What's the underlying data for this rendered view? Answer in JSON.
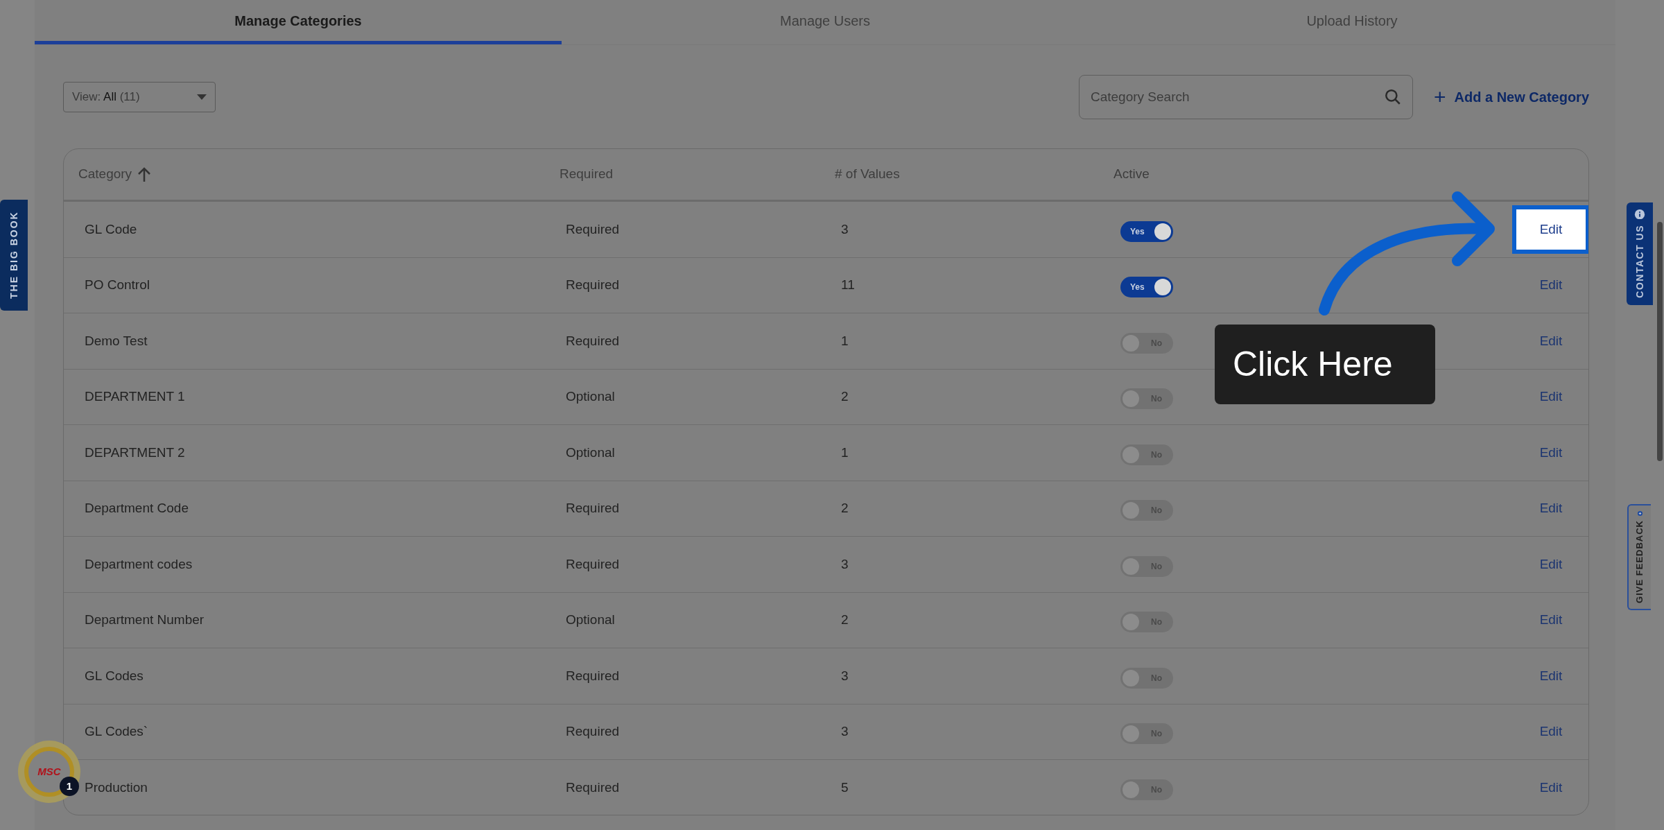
{
  "tabs": [
    {
      "label": "Manage Categories",
      "selected": true
    },
    {
      "label": "Manage Users",
      "selected": false
    },
    {
      "label": "Upload History",
      "selected": false
    }
  ],
  "view_filter": {
    "label": "View:",
    "value": "All",
    "count": "(11)"
  },
  "search": {
    "placeholder": "Category Search"
  },
  "add_button": {
    "icon": "+",
    "label": "Add a New Category"
  },
  "table": {
    "columns": [
      {
        "label": "Category",
        "sorted": true
      },
      {
        "label": "Required",
        "sorted": false
      },
      {
        "label": "# of Values",
        "sorted": false
      },
      {
        "label": "Active",
        "sorted": false
      }
    ],
    "rows": [
      {
        "category": "GL Code",
        "required": "Required",
        "values": "3",
        "active": true,
        "toggle_label": "Yes",
        "action": "Edit",
        "highlighted": true
      },
      {
        "category": "PO Control",
        "required": "Required",
        "values": "11",
        "active": true,
        "toggle_label": "Yes",
        "action": "Edit",
        "highlighted": false
      },
      {
        "category": "Demo Test",
        "required": "Required",
        "values": "1",
        "active": false,
        "toggle_label": "No",
        "action": "Edit",
        "highlighted": false
      },
      {
        "category": "DEPARTMENT 1",
        "required": "Optional",
        "values": "2",
        "active": false,
        "toggle_label": "No",
        "action": "Edit",
        "highlighted": false
      },
      {
        "category": "DEPARTMENT 2",
        "required": "Optional",
        "values": "1",
        "active": false,
        "toggle_label": "No",
        "action": "Edit",
        "highlighted": false
      },
      {
        "category": "Department Code",
        "required": "Required",
        "values": "2",
        "active": false,
        "toggle_label": "No",
        "action": "Edit",
        "highlighted": false
      },
      {
        "category": "Department codes",
        "required": "Required",
        "values": "3",
        "active": false,
        "toggle_label": "No",
        "action": "Edit",
        "highlighted": false
      },
      {
        "category": "Department Number",
        "required": "Optional",
        "values": "2",
        "active": false,
        "toggle_label": "No",
        "action": "Edit",
        "highlighted": false
      },
      {
        "category": "GL Codes",
        "required": "Required",
        "values": "3",
        "active": false,
        "toggle_label": "No",
        "action": "Edit",
        "highlighted": false
      },
      {
        "category": "GL Codes`",
        "required": "Required",
        "values": "3",
        "active": false,
        "toggle_label": "No",
        "action": "Edit",
        "highlighted": false
      },
      {
        "category": "Production",
        "required": "Required",
        "values": "5",
        "active": false,
        "toggle_label": "No",
        "action": "Edit",
        "highlighted": false
      }
    ]
  },
  "side_tabs": {
    "left": "THE BIG BOOK",
    "contact": "CONTACT US",
    "feedback": "GIVE FEEDBACK"
  },
  "assistant": {
    "logo": "MSC",
    "badge": "1"
  },
  "callout": {
    "text": "Click Here"
  }
}
